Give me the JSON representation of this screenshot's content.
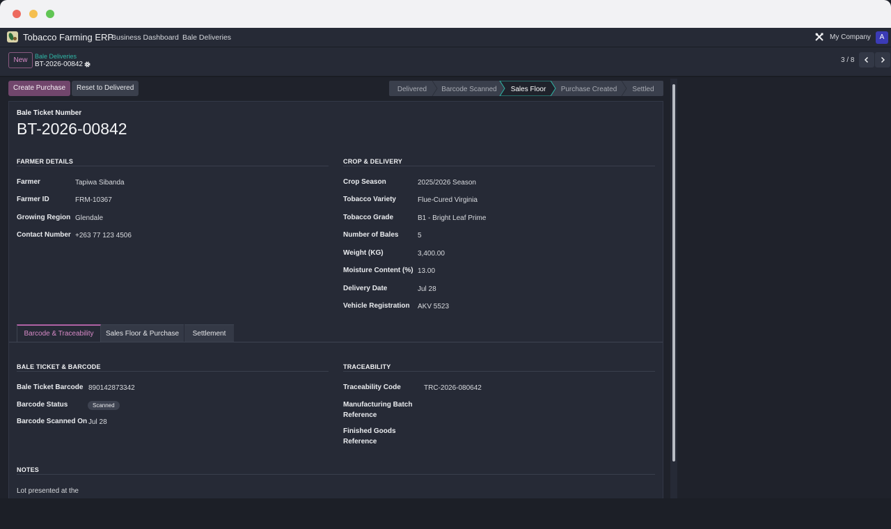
{
  "navbar": {
    "app_name": "Tobacco Farming ERP",
    "links": [
      "Business Dashboard",
      "Bale Deliveries"
    ],
    "company": "My Company",
    "avatar_letter": "A"
  },
  "control": {
    "new_label": "New",
    "breadcrumb_parent": "Bale Deliveries",
    "breadcrumb_current": "BT-2026-00842",
    "pager": "3 / 8"
  },
  "actions": {
    "create_purchase": "Create Purchase",
    "reset_delivered": "Reset to Delivered"
  },
  "stages": {
    "items": [
      "Delivered",
      "Barcode Scanned",
      "Sales Floor",
      "Purchase Created",
      "Settled"
    ],
    "active": "Sales Floor"
  },
  "form": {
    "ticket_label": "Bale Ticket Number",
    "ticket_number": "BT-2026-00842",
    "farmer_section": "FARMER DETAILS",
    "farmer_fields": [
      {
        "label": "Farmer",
        "value": "Tapiwa Sibanda"
      },
      {
        "label": "Farmer ID",
        "value": "FRM-10367"
      },
      {
        "label": "Growing Region",
        "value": "Glendale"
      },
      {
        "label": "Contact Number",
        "value": "+263 77 123 4506"
      }
    ],
    "crop_section": "CROP & DELIVERY",
    "crop_fields": [
      {
        "label": "Crop Season",
        "value": "2025/2026 Season"
      },
      {
        "label": "Tobacco Variety",
        "value": "Flue-Cured Virginia"
      },
      {
        "label": "Tobacco Grade",
        "value": "B1 - Bright Leaf Prime"
      },
      {
        "label": "Number of Bales",
        "value": "5"
      },
      {
        "label": "Weight (KG)",
        "value": "3,400.00"
      },
      {
        "label": "Moisture Content (%)",
        "value": "13.00"
      },
      {
        "label": "Delivery Date",
        "value": "Jul 28"
      },
      {
        "label": "Vehicle Registration",
        "value": "AKV 5523"
      }
    ],
    "tabs": [
      "Barcode & Traceability",
      "Sales Floor & Purchase",
      "Settlement"
    ],
    "barcode_section": "BALE TICKET & BARCODE",
    "barcode_fields": [
      {
        "label": "Bale Ticket Barcode",
        "value": "890142873342"
      },
      {
        "label": "Barcode Status",
        "value": "Scanned"
      },
      {
        "label": "Barcode Scanned On",
        "value": "Jul 28"
      }
    ],
    "trace_section": "TRACEABILITY",
    "trace_fields": [
      {
        "label": "Traceability Code",
        "value": "TRC-2026-080642"
      },
      {
        "label": "Manufacturing Batch Reference",
        "label_lines": [
          "Manufacturing Batch",
          "Reference"
        ],
        "value": ""
      },
      {
        "label": "Finished Goods Reference",
        "label_lines": [
          "Finished Goods",
          "Reference"
        ],
        "value": ""
      }
    ],
    "notes_section": "NOTES",
    "notes_text": "Lot presented at the"
  },
  "colors": {
    "brand": "#71466c",
    "accent": "#d78ac7",
    "teal": "#2fb7a7",
    "background": "#1f222b",
    "sheet": "#262a36"
  }
}
